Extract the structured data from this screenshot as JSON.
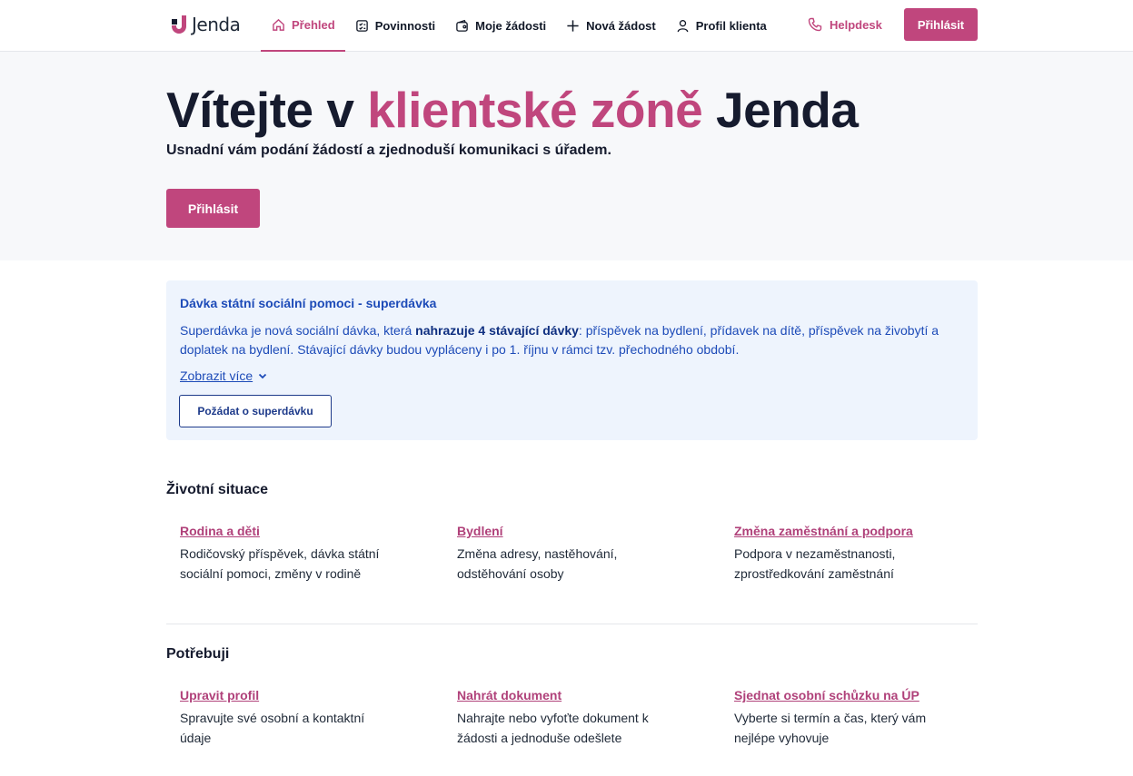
{
  "brand": {
    "logo_text": "Jenda",
    "accent_color": "#c0467d",
    "info_color": "#1d4bb8"
  },
  "nav": {
    "items": [
      {
        "label": "Přehled",
        "icon": "home-icon",
        "active": true
      },
      {
        "label": "Povinnosti",
        "icon": "clipboard-icon",
        "active": false
      },
      {
        "label": "Moje žádosti",
        "icon": "wallet-icon",
        "active": false
      },
      {
        "label": "Nová žádost",
        "icon": "plus-icon",
        "active": false
      },
      {
        "label": "Profil klienta",
        "icon": "user-icon",
        "active": false
      }
    ],
    "helpdesk_label": "Helpdesk",
    "helpdesk_icon": "phone-icon",
    "login_label": "Přihlásit"
  },
  "hero": {
    "title_pre": "Vítejte v ",
    "title_accent": "klientské zóně",
    "title_post": " Jenda",
    "subtitle": "Usnadní vám podání žádostí a zjednoduší komunikaci s úřadem.",
    "login_label": "Přihlásit"
  },
  "info": {
    "title": "Dávka státní sociální pomoci - superdávka",
    "text_pre": "Superdávka je nová sociální dávka, která ",
    "text_bold": "nahrazuje 4 stávající dávky",
    "text_post": ": příspěvek na bydlení, přídavek na dítě, příspěvek na živobytí a doplatek na bydlení. Stávající dávky budou vypláceny i po 1. říjnu v rámci tzv. přechodného období.",
    "show_more": "Zobrazit více",
    "apply_label": "Požádat o superdávku"
  },
  "life_situations": {
    "title": "Životní situace",
    "items": [
      {
        "link": "Rodina a děti",
        "desc": "Rodičovský příspěvek, dávka státní sociální pomoci, změny v rodině"
      },
      {
        "link": "Bydlení",
        "desc": "Změna adresy, nastěhování, odstěhování osoby"
      },
      {
        "link": "Změna zaměstnání a podpora",
        "desc": "Podpora v nezaměstnanosti, zprostředkování zaměstnání"
      }
    ]
  },
  "needs": {
    "title": "Potřebuji",
    "items": [
      {
        "link": "Upravit profil",
        "desc": "Spravujte své osobní a kontaktní údaje"
      },
      {
        "link": "Nahrát dokument",
        "desc": "Nahrajte nebo vyfoťte dokument k žádosti a jednoduše odešlete"
      },
      {
        "link": "Sjednat osobní schůzku na ÚP",
        "desc": "Vyberte si termín a čas, který vám nejlépe vyhovuje"
      }
    ]
  }
}
